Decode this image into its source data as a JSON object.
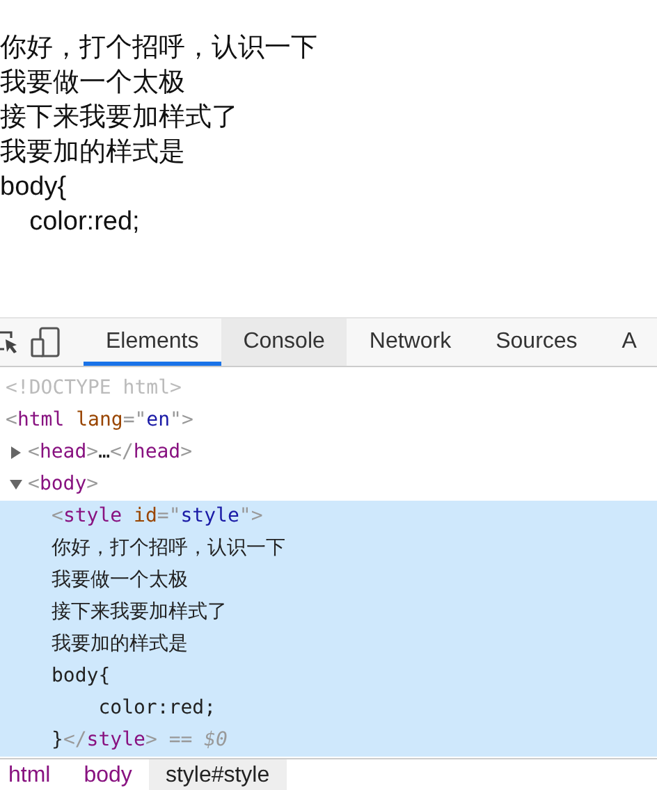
{
  "page": {
    "lines": [
      "你好，打个招呼，认识一下",
      "我要做一个太极",
      "接下来我要加样式了",
      "我要加的样式是",
      "body{",
      "    color:red;"
    ]
  },
  "devtools": {
    "tabs": [
      {
        "label": "Elements",
        "selected": true,
        "hovered": false
      },
      {
        "label": "Console",
        "selected": false,
        "hovered": true
      },
      {
        "label": "Network",
        "selected": false,
        "hovered": false
      },
      {
        "label": "Sources",
        "selected": false,
        "hovered": false
      },
      {
        "label": "A",
        "selected": false,
        "hovered": false
      }
    ],
    "tree": [
      {
        "kind": "doctype",
        "text": "<!DOCTYPE html>"
      },
      {
        "kind": "element",
        "tokens": [
          {
            "kind": "punct",
            "text": "<"
          },
          {
            "kind": "tag",
            "text": "html"
          },
          {
            "kind": "attr",
            "text": " lang"
          },
          {
            "kind": "punct",
            "text": "=\""
          },
          {
            "kind": "value",
            "text": "en"
          },
          {
            "kind": "punct",
            "text": "\">"
          }
        ],
        "children": [
          {
            "kind": "element",
            "expanded": false,
            "tokens": [
              {
                "kind": "punct",
                "text": "<"
              },
              {
                "kind": "tag",
                "text": "head"
              },
              {
                "kind": "punct",
                "text": ">"
              },
              {
                "kind": "text",
                "text": "…"
              },
              {
                "kind": "punct",
                "text": "</"
              },
              {
                "kind": "tag",
                "text": "head"
              },
              {
                "kind": "punct",
                "text": ">"
              }
            ]
          },
          {
            "kind": "element",
            "expanded": true,
            "tokens": [
              {
                "kind": "punct",
                "text": "<"
              },
              {
                "kind": "tag",
                "text": "body"
              },
              {
                "kind": "punct",
                "text": ">"
              }
            ],
            "children": [
              {
                "kind": "block",
                "selected": true,
                "lines": [
                  [
                    {
                      "kind": "punct",
                      "text": "<"
                    },
                    {
                      "kind": "tag",
                      "text": "style"
                    },
                    {
                      "kind": "attr",
                      "text": " id"
                    },
                    {
                      "kind": "punct",
                      "text": "=\""
                    },
                    {
                      "kind": "value",
                      "text": "style"
                    },
                    {
                      "kind": "punct",
                      "text": "\">"
                    }
                  ],
                  [
                    {
                      "kind": "text",
                      "text": "你好，打个招呼，认识一下"
                    }
                  ],
                  [
                    {
                      "kind": "text",
                      "text": "我要做一个太极"
                    }
                  ],
                  [
                    {
                      "kind": "text",
                      "text": "接下来我要加样式了"
                    }
                  ],
                  [
                    {
                      "kind": "text",
                      "text": "我要加的样式是"
                    }
                  ],
                  [
                    {
                      "kind": "text",
                      "text": "body{"
                    }
                  ],
                  [
                    {
                      "kind": "text",
                      "text": "    color:red;"
                    }
                  ],
                  [
                    {
                      "kind": "text",
                      "text": "}"
                    },
                    {
                      "kind": "punct",
                      "text": "</"
                    },
                    {
                      "kind": "tag",
                      "text": "style"
                    },
                    {
                      "kind": "punct",
                      "text": ">"
                    },
                    {
                      "kind": "ref",
                      "text": " == $0"
                    }
                  ]
                ]
              }
            ]
          }
        ]
      }
    ],
    "breadcrumbs": [
      {
        "label": "html",
        "selected": false
      },
      {
        "label": "body",
        "selected": false
      },
      {
        "label": "style#style",
        "selected": true
      }
    ]
  }
}
